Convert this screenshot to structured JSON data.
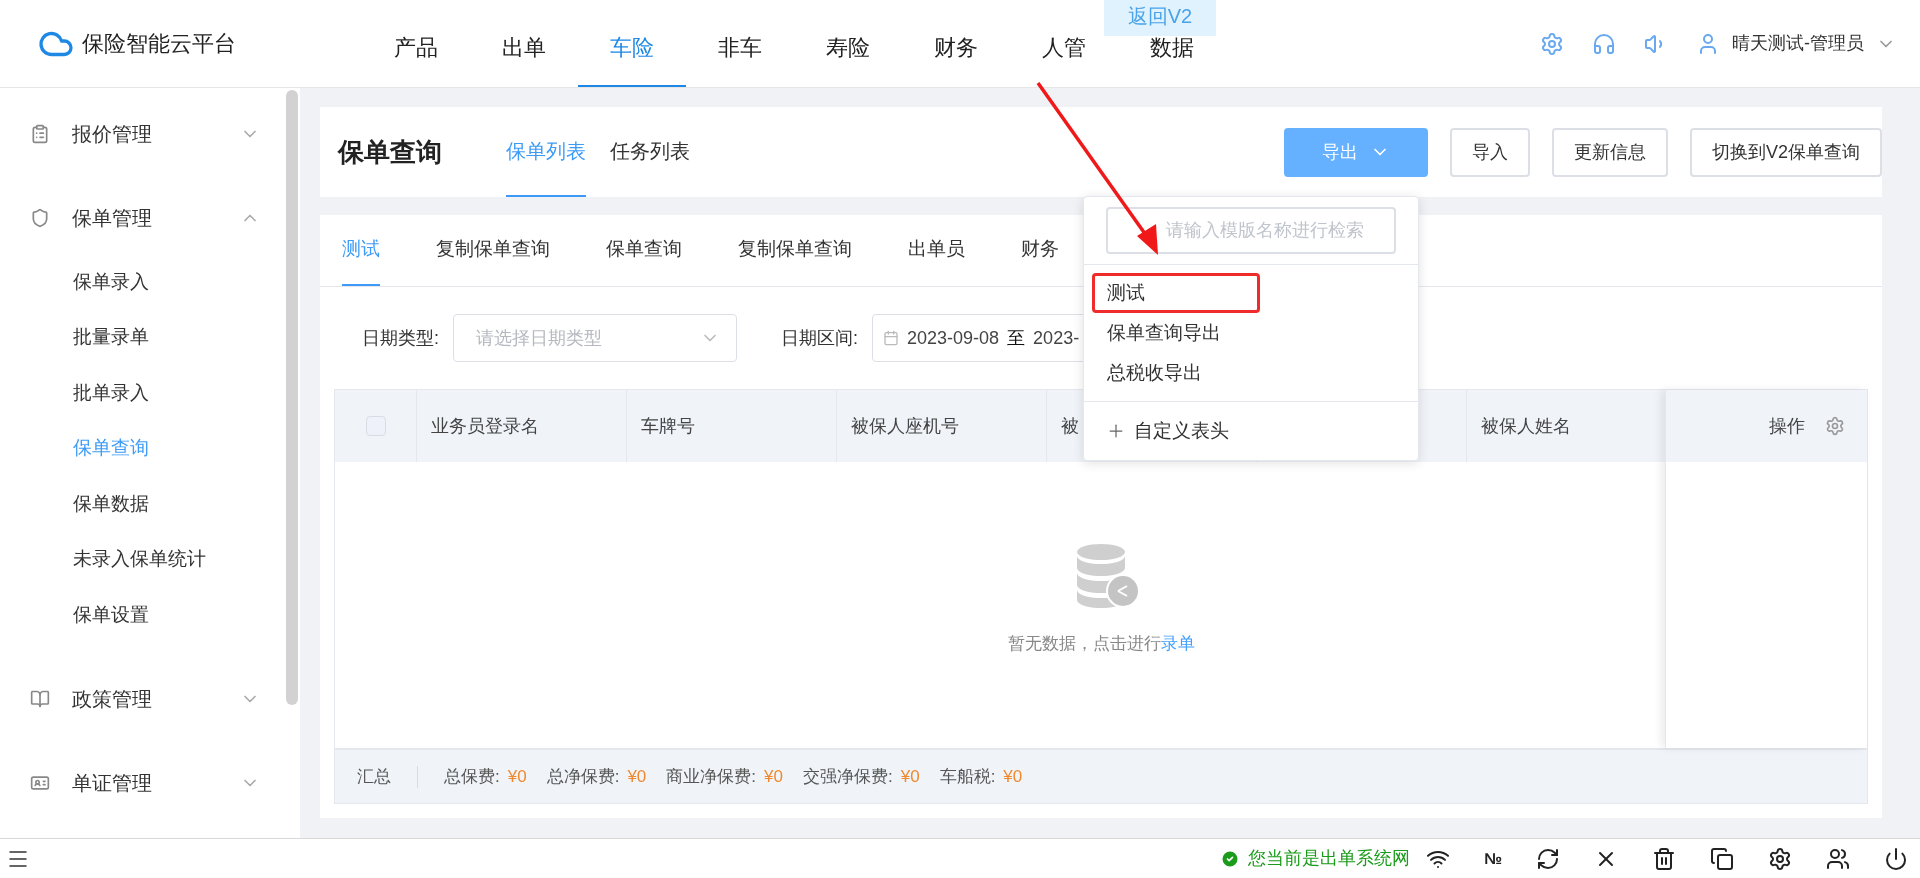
{
  "header": {
    "logo": "保险智能云平台",
    "badge": "返回V2",
    "user": "晴天测试-管理员",
    "nav": [
      {
        "label": "产品",
        "selected": false
      },
      {
        "label": "出单",
        "selected": false
      },
      {
        "label": "车险",
        "selected": true
      },
      {
        "label": "非车",
        "selected": false
      },
      {
        "label": "寿险",
        "selected": false
      },
      {
        "label": "财务",
        "selected": false
      },
      {
        "label": "人管",
        "selected": false
      },
      {
        "label": "数据",
        "selected": false
      }
    ]
  },
  "sidebar": {
    "items": [
      {
        "label": "报价管理",
        "expanded": false
      },
      {
        "label": "保单管理",
        "expanded": true,
        "children": [
          {
            "label": "保单录入",
            "selected": false
          },
          {
            "label": "批量录单",
            "selected": false
          },
          {
            "label": "批单录入",
            "selected": false
          },
          {
            "label": "保单查询",
            "selected": true
          },
          {
            "label": "保单数据",
            "selected": false
          },
          {
            "label": "未录入保单统计",
            "selected": false
          },
          {
            "label": "保单设置",
            "selected": false
          }
        ]
      },
      {
        "label": "政策管理",
        "expanded": false
      },
      {
        "label": "单证管理",
        "expanded": false
      }
    ]
  },
  "page": {
    "title": "保单查询",
    "tabs": [
      {
        "label": "保单列表",
        "selected": true
      },
      {
        "label": "任务列表",
        "selected": false
      }
    ],
    "buttons": [
      {
        "label": "导出",
        "kind": "primary"
      },
      {
        "label": "导入",
        "kind": "plain"
      },
      {
        "label": "更新信息",
        "kind": "plain"
      },
      {
        "label": "切换到V2保单查询",
        "kind": "plain"
      }
    ]
  },
  "query_tabs": [
    {
      "label": "测试",
      "selected": true
    },
    {
      "label": "复制保单查询",
      "selected": false
    },
    {
      "label": "保单查询",
      "selected": false
    },
    {
      "label": "复制保单查询",
      "selected": false
    },
    {
      "label": "出单员",
      "selected": false
    },
    {
      "label": "财务",
      "selected": false
    }
  ],
  "filters": {
    "date_type": {
      "label": "日期类型:",
      "placeholder": "请选择日期类型"
    },
    "date_range": {
      "label": "日期区间:",
      "start": "2023-09-08",
      "separator": "至",
      "end": "2023-"
    }
  },
  "table": {
    "select_all": {
      "checked": false
    },
    "columns": [
      "业务员登录名",
      "车牌号",
      "被保人座机号",
      "被",
      "",
      "被保人姓名"
    ],
    "action_column": "操作",
    "empty_text": "暂无数据，点击进行",
    "empty_link": "录单"
  },
  "summary": {
    "label": "汇总",
    "items": [
      {
        "label": "总保费:",
        "value": "¥0"
      },
      {
        "label": "总净保费:",
        "value": "¥0"
      },
      {
        "label": "商业净保费:",
        "value": "¥0"
      },
      {
        "label": "交强净保费:",
        "value": "¥0"
      },
      {
        "label": "车船税:",
        "value": "¥0"
      }
    ]
  },
  "export_menu": {
    "placeholder": "请输入模版名称进行检索",
    "items": [
      {
        "label": "测试",
        "highlighted": true
      },
      {
        "label": "保单查询导出",
        "highlighted": false
      },
      {
        "label": "总税收导出",
        "highlighted": false
      }
    ],
    "footer": "自定义表头"
  },
  "status_bar": {
    "message": "您当前是出单系统网",
    "key_label": "№"
  }
}
